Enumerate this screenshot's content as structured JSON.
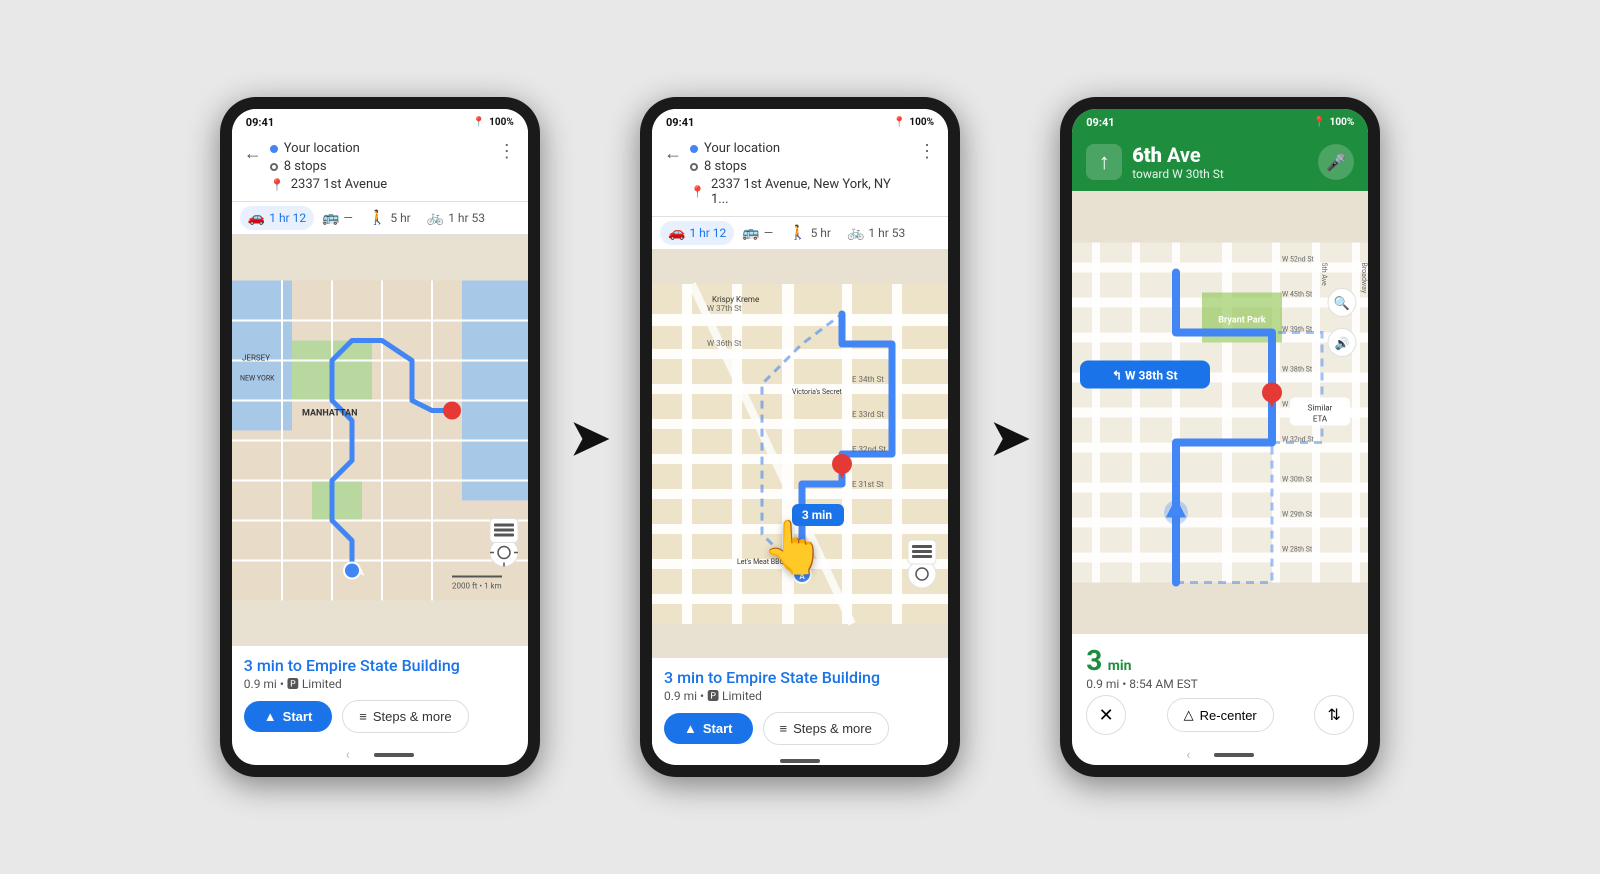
{
  "scene": {
    "phones": [
      {
        "id": "phone1",
        "statusBar": {
          "time": "09:41",
          "battery": "100%"
        },
        "header": {
          "origin": "Your location",
          "stops": "8 stops",
          "destination": "2337 1st Avenue",
          "showMenuDots": true
        },
        "tabs": [
          {
            "icon": "🚗",
            "label": "1 hr 12",
            "active": true
          },
          {
            "icon": "🚌",
            "label": "—",
            "active": false
          },
          {
            "icon": "🚶",
            "label": "5 hr",
            "active": false
          },
          {
            "icon": "🚲",
            "label": "1 hr 53",
            "active": false
          }
        ],
        "etaBar": {
          "headline": "3 min to Empire State Building",
          "sub": "0.9 mi • 🅿 Limited"
        },
        "buttons": {
          "start": "Start",
          "steps": "Steps & more"
        }
      },
      {
        "id": "phone2",
        "statusBar": {
          "time": "09:41",
          "battery": "100%"
        },
        "header": {
          "origin": "Your location",
          "stops": "8 stops",
          "destination": "2337 1st Avenue, New York, NY 1...",
          "showMenuDots": true
        },
        "tabs": [
          {
            "icon": "🚗",
            "label": "1 hr 12",
            "active": true
          },
          {
            "icon": "🚌",
            "label": "—",
            "active": false
          },
          {
            "icon": "🚶",
            "label": "5 hr",
            "active": false
          },
          {
            "icon": "🚲",
            "label": "1 hr 53",
            "active": false
          }
        ],
        "etaBar": {
          "headline": "3 min to Empire State Building",
          "sub": "0.9 mi • 🅿 Limited"
        },
        "buttons": {
          "start": "Start",
          "steps": "Steps & more"
        },
        "showTapCursor": true
      },
      {
        "id": "phone3",
        "statusBar": {
          "time": "09:41",
          "battery": "100%"
        },
        "navHeader": {
          "direction": "↑",
          "street": "6th Ave",
          "toward": "toward W 30th St"
        },
        "turnBadge": "↰  W 38th St",
        "similarEta": "Similar\nETA",
        "navBottom": {
          "time": "3",
          "unit": "min",
          "details": "0.9 mi • 8:54 AM EST",
          "recenter": "Re-center"
        }
      }
    ],
    "arrows": [
      "→",
      "→"
    ]
  }
}
